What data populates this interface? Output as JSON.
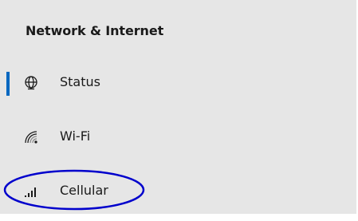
{
  "section": {
    "title": "Network & Internet"
  },
  "nav": {
    "items": [
      {
        "label": "Status",
        "icon": "globe-icon",
        "selected": true
      },
      {
        "label": "Wi-Fi",
        "icon": "wifi-icon",
        "selected": false
      },
      {
        "label": "Cellular",
        "icon": "cellular-signal-icon",
        "selected": false
      }
    ]
  },
  "colors": {
    "panel_background": "#e6e6e6",
    "page_background": "#ffffff",
    "selected_indicator": "#0067c0",
    "annotation_outline": "#0000cc",
    "text": "#1a1a1a"
  }
}
